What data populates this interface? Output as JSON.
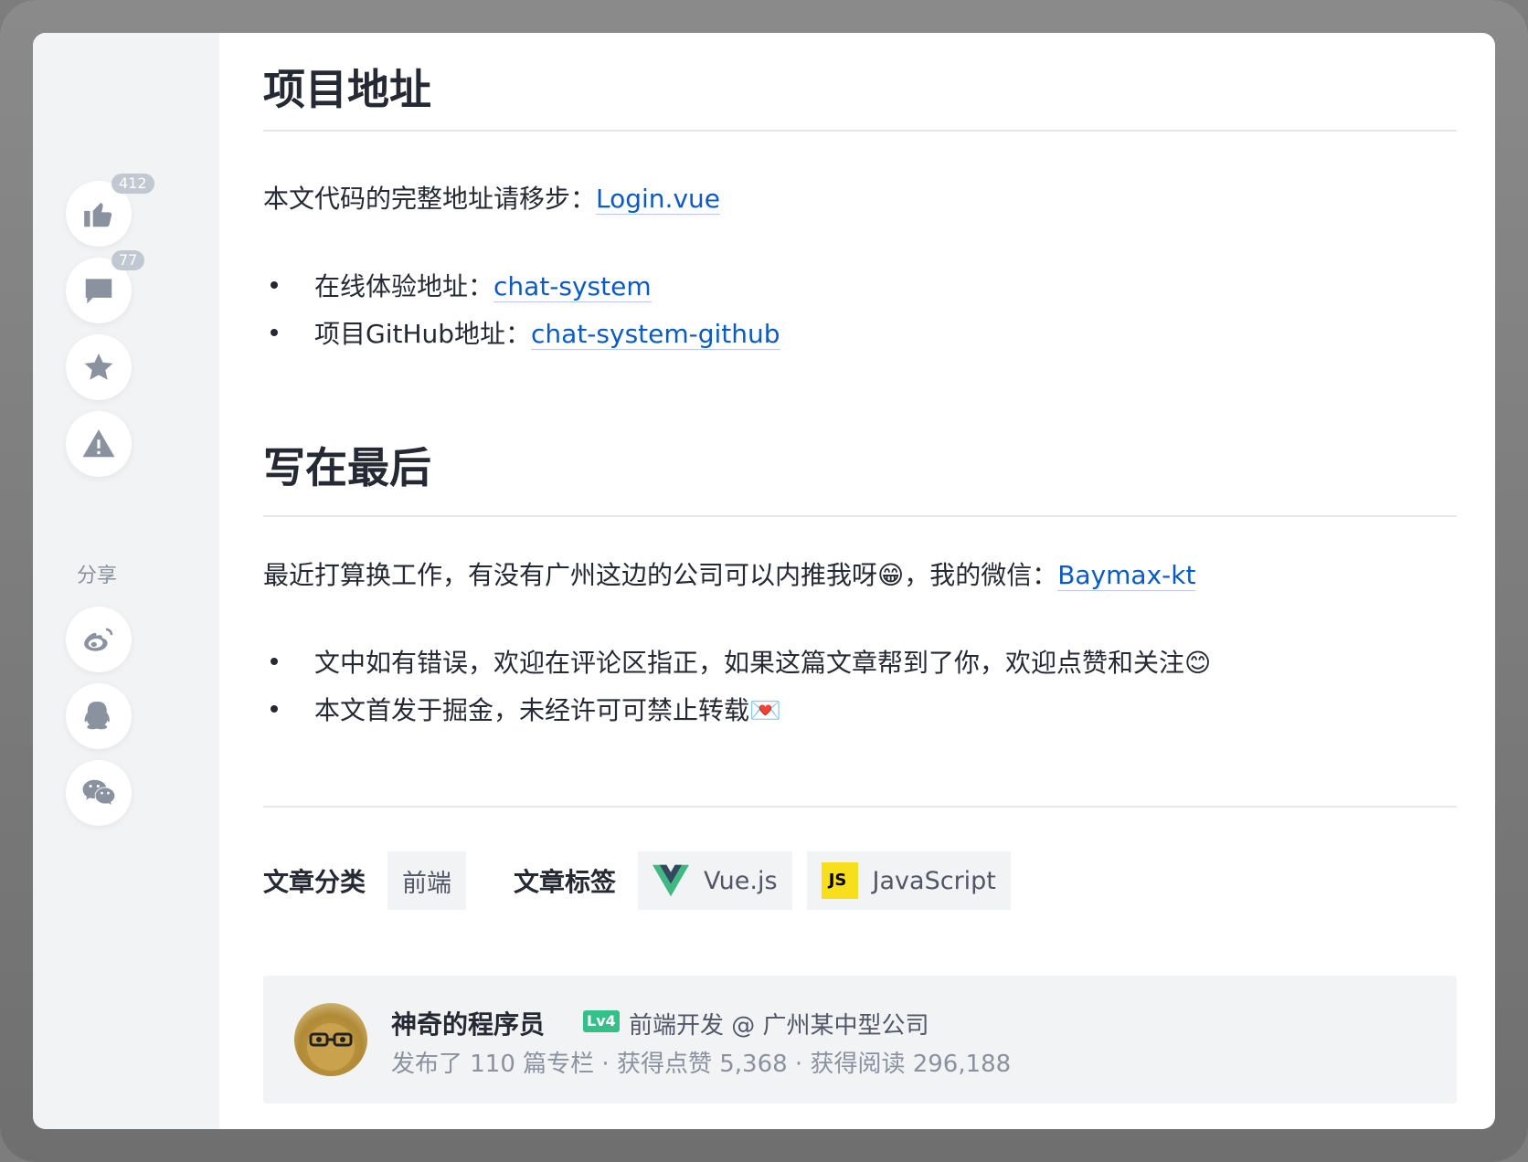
{
  "sidebar": {
    "like_count": "412",
    "comment_count": "77",
    "share_label": "分享",
    "icons": [
      "thumbs-up-icon",
      "comment-icon",
      "star-icon",
      "warning-icon",
      "weibo-icon",
      "qq-icon",
      "wechat-icon"
    ]
  },
  "section1": {
    "title": "项目地址",
    "intro_text": "本文代码的完整地址请移步：",
    "intro_link": "Login.vue",
    "items": [
      {
        "text": "在线体验地址：",
        "link": "chat-system"
      },
      {
        "text": "项目GitHub地址：",
        "link": "chat-system-github"
      }
    ]
  },
  "section2": {
    "title": "写在最后",
    "intro_text": "最近打算换工作，有没有广州这边的公司可以内推我呀😁，我的微信：",
    "intro_link": "Baymax-kt",
    "items": [
      {
        "text": "文中如有错误，欢迎在评论区指正，如果这篇文章帮到了你，欢迎点赞和关注😊"
      },
      {
        "text": "本文首发于掘金，未经许可可禁止转载💌"
      }
    ]
  },
  "meta": {
    "category_label": "文章分类",
    "category": "前端",
    "tags_label": "文章标签",
    "tags": [
      "Vue.js",
      "JavaScript"
    ],
    "js_logo_text": "JS"
  },
  "author": {
    "name": "神奇的程序员",
    "level": "Lv4",
    "title": "前端开发 @ 广州某中型公司",
    "stats": "发布了 110 篇专栏 · 获得点赞 5,368 · 获得阅读 296,188"
  },
  "colors": {
    "link": "#0b5bc2",
    "level_badge": "#35c08a",
    "sidebar_bg": "#f2f3f5"
  }
}
